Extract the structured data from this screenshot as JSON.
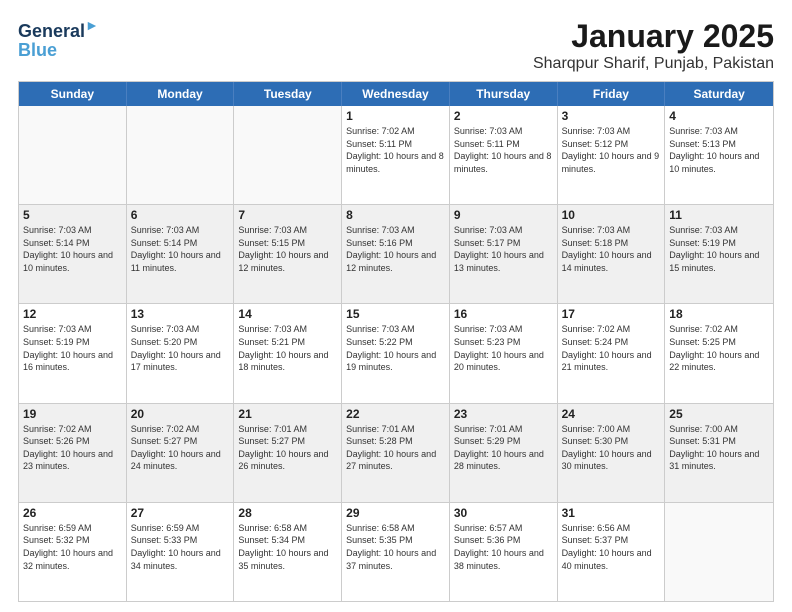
{
  "header": {
    "logo_line1": "General",
    "logo_line2": "Blue",
    "title": "January 2025",
    "subtitle": "Sharqpur Sharif, Punjab, Pakistan"
  },
  "weekdays": [
    "Sunday",
    "Monday",
    "Tuesday",
    "Wednesday",
    "Thursday",
    "Friday",
    "Saturday"
  ],
  "rows": [
    [
      {
        "day": "",
        "info": "",
        "empty": true
      },
      {
        "day": "",
        "info": "",
        "empty": true
      },
      {
        "day": "",
        "info": "",
        "empty": true
      },
      {
        "day": "1",
        "info": "Sunrise: 7:02 AM\nSunset: 5:11 PM\nDaylight: 10 hours and 8 minutes."
      },
      {
        "day": "2",
        "info": "Sunrise: 7:03 AM\nSunset: 5:11 PM\nDaylight: 10 hours and 8 minutes."
      },
      {
        "day": "3",
        "info": "Sunrise: 7:03 AM\nSunset: 5:12 PM\nDaylight: 10 hours and 9 minutes."
      },
      {
        "day": "4",
        "info": "Sunrise: 7:03 AM\nSunset: 5:13 PM\nDaylight: 10 hours and 10 minutes."
      }
    ],
    [
      {
        "day": "5",
        "info": "Sunrise: 7:03 AM\nSunset: 5:14 PM\nDaylight: 10 hours and 10 minutes.",
        "shaded": true
      },
      {
        "day": "6",
        "info": "Sunrise: 7:03 AM\nSunset: 5:14 PM\nDaylight: 10 hours and 11 minutes.",
        "shaded": true
      },
      {
        "day": "7",
        "info": "Sunrise: 7:03 AM\nSunset: 5:15 PM\nDaylight: 10 hours and 12 minutes.",
        "shaded": true
      },
      {
        "day": "8",
        "info": "Sunrise: 7:03 AM\nSunset: 5:16 PM\nDaylight: 10 hours and 12 minutes.",
        "shaded": true
      },
      {
        "day": "9",
        "info": "Sunrise: 7:03 AM\nSunset: 5:17 PM\nDaylight: 10 hours and 13 minutes.",
        "shaded": true
      },
      {
        "day": "10",
        "info": "Sunrise: 7:03 AM\nSunset: 5:18 PM\nDaylight: 10 hours and 14 minutes.",
        "shaded": true
      },
      {
        "day": "11",
        "info": "Sunrise: 7:03 AM\nSunset: 5:19 PM\nDaylight: 10 hours and 15 minutes.",
        "shaded": true
      }
    ],
    [
      {
        "day": "12",
        "info": "Sunrise: 7:03 AM\nSunset: 5:19 PM\nDaylight: 10 hours and 16 minutes."
      },
      {
        "day": "13",
        "info": "Sunrise: 7:03 AM\nSunset: 5:20 PM\nDaylight: 10 hours and 17 minutes."
      },
      {
        "day": "14",
        "info": "Sunrise: 7:03 AM\nSunset: 5:21 PM\nDaylight: 10 hours and 18 minutes."
      },
      {
        "day": "15",
        "info": "Sunrise: 7:03 AM\nSunset: 5:22 PM\nDaylight: 10 hours and 19 minutes."
      },
      {
        "day": "16",
        "info": "Sunrise: 7:03 AM\nSunset: 5:23 PM\nDaylight: 10 hours and 20 minutes."
      },
      {
        "day": "17",
        "info": "Sunrise: 7:02 AM\nSunset: 5:24 PM\nDaylight: 10 hours and 21 minutes."
      },
      {
        "day": "18",
        "info": "Sunrise: 7:02 AM\nSunset: 5:25 PM\nDaylight: 10 hours and 22 minutes."
      }
    ],
    [
      {
        "day": "19",
        "info": "Sunrise: 7:02 AM\nSunset: 5:26 PM\nDaylight: 10 hours and 23 minutes.",
        "shaded": true
      },
      {
        "day": "20",
        "info": "Sunrise: 7:02 AM\nSunset: 5:27 PM\nDaylight: 10 hours and 24 minutes.",
        "shaded": true
      },
      {
        "day": "21",
        "info": "Sunrise: 7:01 AM\nSunset: 5:27 PM\nDaylight: 10 hours and 26 minutes.",
        "shaded": true
      },
      {
        "day": "22",
        "info": "Sunrise: 7:01 AM\nSunset: 5:28 PM\nDaylight: 10 hours and 27 minutes.",
        "shaded": true
      },
      {
        "day": "23",
        "info": "Sunrise: 7:01 AM\nSunset: 5:29 PM\nDaylight: 10 hours and 28 minutes.",
        "shaded": true
      },
      {
        "day": "24",
        "info": "Sunrise: 7:00 AM\nSunset: 5:30 PM\nDaylight: 10 hours and 30 minutes.",
        "shaded": true
      },
      {
        "day": "25",
        "info": "Sunrise: 7:00 AM\nSunset: 5:31 PM\nDaylight: 10 hours and 31 minutes.",
        "shaded": true
      }
    ],
    [
      {
        "day": "26",
        "info": "Sunrise: 6:59 AM\nSunset: 5:32 PM\nDaylight: 10 hours and 32 minutes."
      },
      {
        "day": "27",
        "info": "Sunrise: 6:59 AM\nSunset: 5:33 PM\nDaylight: 10 hours and 34 minutes."
      },
      {
        "day": "28",
        "info": "Sunrise: 6:58 AM\nSunset: 5:34 PM\nDaylight: 10 hours and 35 minutes."
      },
      {
        "day": "29",
        "info": "Sunrise: 6:58 AM\nSunset: 5:35 PM\nDaylight: 10 hours and 37 minutes."
      },
      {
        "day": "30",
        "info": "Sunrise: 6:57 AM\nSunset: 5:36 PM\nDaylight: 10 hours and 38 minutes."
      },
      {
        "day": "31",
        "info": "Sunrise: 6:56 AM\nSunset: 5:37 PM\nDaylight: 10 hours and 40 minutes."
      },
      {
        "day": "",
        "info": "",
        "empty": true
      }
    ]
  ]
}
